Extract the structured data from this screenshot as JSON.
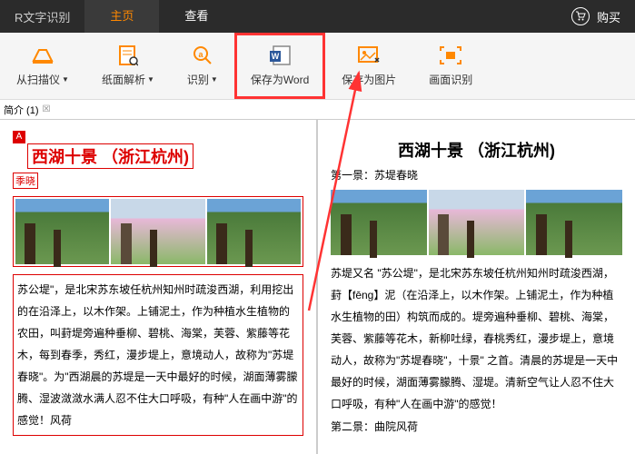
{
  "header": {
    "title": "R文字识别",
    "tabs": {
      "home": "主页",
      "view": "查看"
    },
    "buy": "购买"
  },
  "toolbar": {
    "scanner": "从扫描仪",
    "page_analyze": "纸面解析",
    "recognize": "识别",
    "save_word": "保存为Word",
    "save_image": "保存为图片",
    "screen_recognize": "画面识别"
  },
  "subbar": {
    "label": "简介 (1)"
  },
  "left_doc": {
    "title": "西湖十景 （浙江杭州)",
    "subtitle": "季晓",
    "body": "苏公堤\"，是北宋苏东坡任杭州知州时疏浚西湖，利用挖出的在沿泽上，以木作架。上铺泥土，作为种植水生植物的农田，叫葑堤旁遍种垂柳、碧桃、海棠，芙蓉、紫藤等花木，每到春季，秀红，漫步堤上，意境动人，故称为\"苏堤春晓\"。为\"西湖晨的苏堤是一天中最好的时候，湖面薄雾朦腾、湿波潋潋水满人忍不住大口呼吸，有种\"人在画中游\"的感觉！风荷"
  },
  "right_doc": {
    "title": "西湖十景 （浙江杭州)",
    "scene1": "第一景：苏堤春晓",
    "body": "苏堤又名 \"苏公堤\"，是北宋苏东坡任杭州知州时疏浚西湖，葑【fēng】泥（在沿泽上，以木作架。上铺泥土，作为种植水生植物的田）构筑而成的。堤旁遍种垂柳、碧桃、海棠，芙蓉、紫藤等花木，新柳吐绿，春桃秀红，漫步堤上，意境动人，故称为\"苏堤春晓\"，十景\" 之首。清晨的苏堤是一天中最好的时候，湖面薄雾朦腾、湿堤。清新空气让人忍不住大口呼吸，有种\"人在画中游\"的感觉！",
    "scene2": "第二景：曲院风荷"
  }
}
